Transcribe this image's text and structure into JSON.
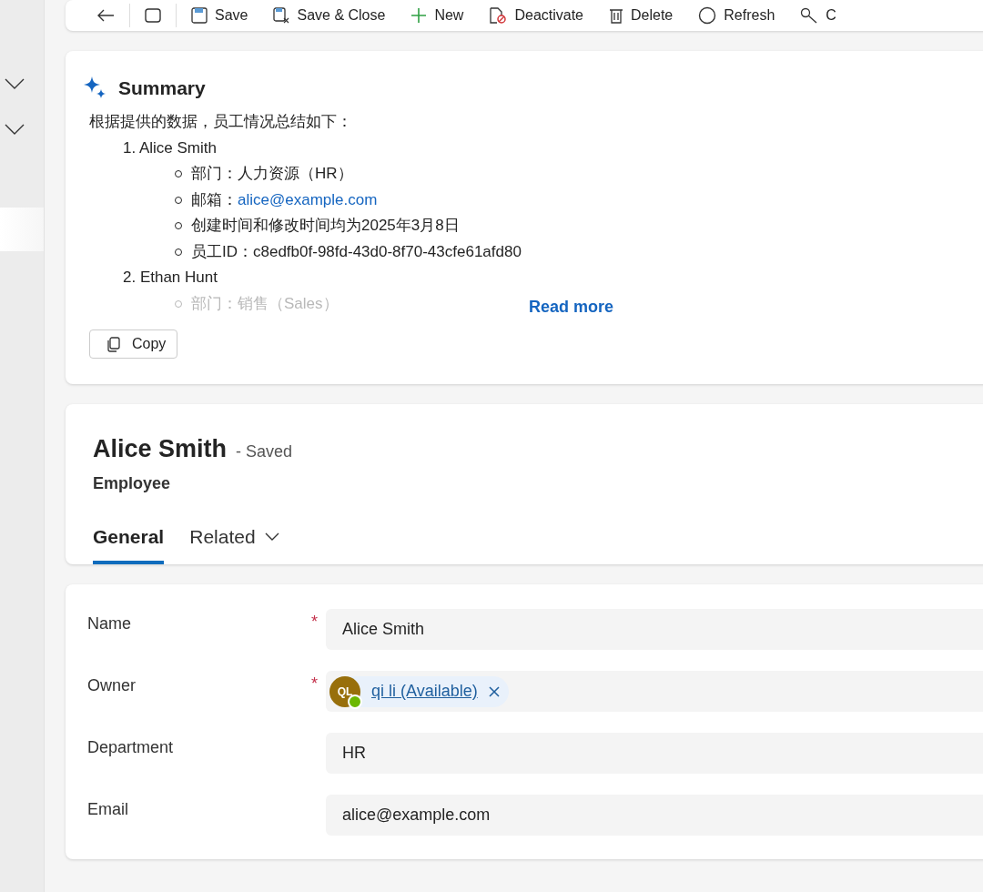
{
  "sidebar": {
    "items": [
      {
        "kind": "group",
        "expanded": false
      },
      {
        "kind": "group",
        "expanded": false
      },
      {
        "kind": "item",
        "selected": true
      }
    ]
  },
  "toolbar": {
    "items": [
      {
        "kind": "back"
      },
      {
        "kind": "window"
      },
      {
        "kind": "save",
        "label": "Save"
      },
      {
        "kind": "save-close",
        "label": "Save & Close"
      },
      {
        "kind": "new",
        "label": "New"
      },
      {
        "kind": "deactivate",
        "label": "Deactivate"
      },
      {
        "kind": "delete",
        "label": "Delete"
      },
      {
        "kind": "refresh",
        "label": "Refresh"
      },
      {
        "kind": "tool",
        "label": "C"
      }
    ]
  },
  "summary": {
    "title": "Summary",
    "intro": "根据提供的数据，员工情况总结如下：",
    "entries": [
      {
        "number": "1.",
        "name": "Alice Smith",
        "details": [
          {
            "text": "部门：人力资源（HR）",
            "faded": false
          },
          {
            "text": "邮箱：",
            "link": "alice@example.com",
            "faded": false
          },
          {
            "text": "创建时间和修改时间均为2025年3月8日",
            "faded": false
          },
          {
            "text": "员工ID：c8edfb0f-98fd-43d0-8f70-43cfe61afd80",
            "faded": false
          }
        ]
      },
      {
        "number": "2.",
        "name": "Ethan Hunt",
        "details": [
          {
            "text": "部门：销售（Sales）",
            "faded": true
          }
        ]
      }
    ],
    "read_more": "Read more",
    "copy": "Copy"
  },
  "record": {
    "title": "Alice Smith",
    "status": "- Saved",
    "entity": "Employee",
    "tabs": [
      {
        "label": "General",
        "selected": true,
        "has_menu": false
      },
      {
        "label": "Related",
        "selected": false,
        "has_menu": true
      }
    ]
  },
  "form": {
    "required_mark": "*",
    "fields": [
      {
        "label": "Name",
        "required": true,
        "kind": "text",
        "value": "Alice Smith"
      },
      {
        "label": "Owner",
        "required": true,
        "kind": "lookup",
        "initials": "QL",
        "value": "qi li (Available)",
        "available": true
      },
      {
        "label": "Department",
        "required": false,
        "kind": "text",
        "value": "HR"
      },
      {
        "label": "Email",
        "required": false,
        "kind": "text",
        "value": "alice@example.com"
      }
    ]
  }
}
